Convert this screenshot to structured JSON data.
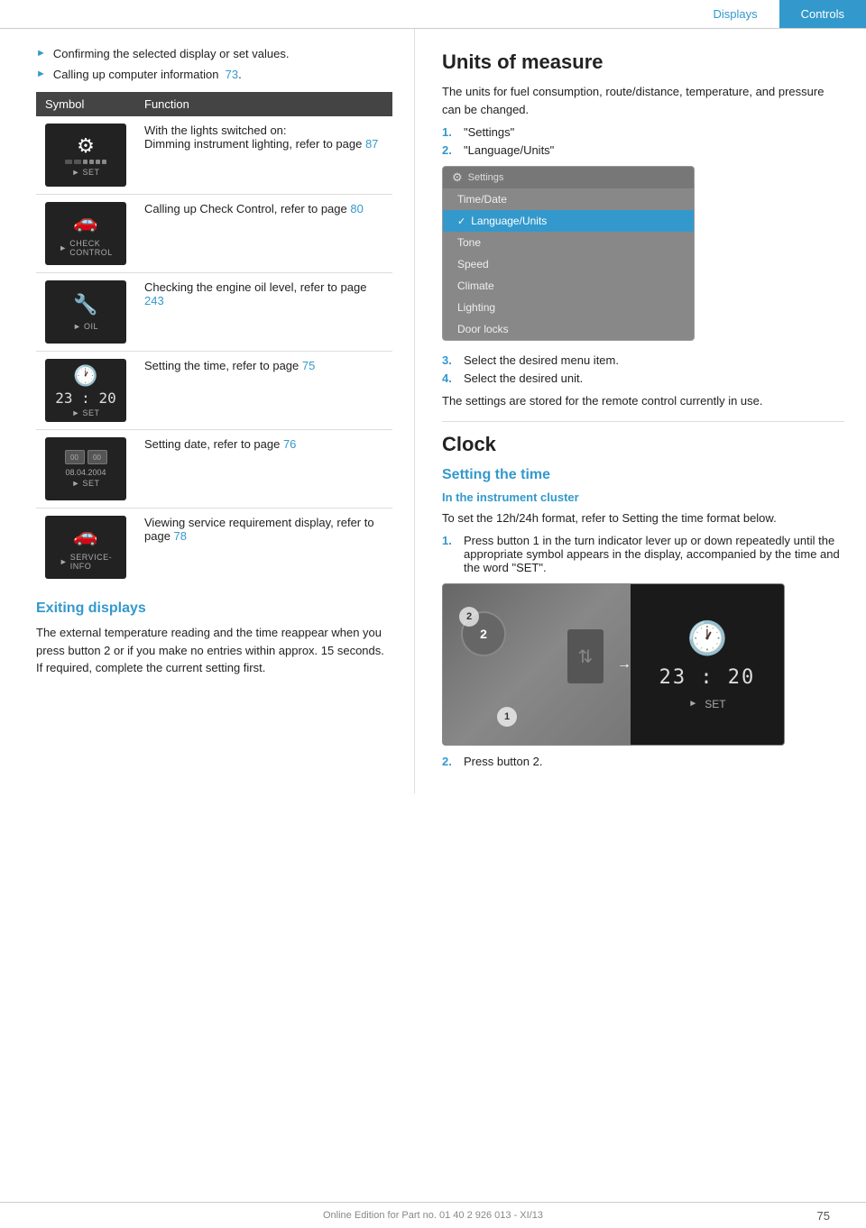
{
  "header": {
    "tab_displays": "Displays",
    "tab_controls": "Controls"
  },
  "left": {
    "bullets": [
      {
        "text": "Confirming the selected display or set values."
      },
      {
        "text": "Calling up computer information",
        "link": "73",
        "link_suffix": "."
      }
    ],
    "table": {
      "col1": "Symbol",
      "col2": "Function",
      "rows": [
        {
          "icon": "⚙",
          "icon_label": "SET",
          "desc_line1": "With the lights switched on:",
          "desc_line2": "Dimming instrument lighting, refer to page ",
          "link": "87"
        },
        {
          "icon": "🚗",
          "icon_label": "CHECK\nCONTROL",
          "desc_line1": "Calling up Check Control, refer to page ",
          "link": "80"
        },
        {
          "icon": "🔧",
          "icon_label": "OIL",
          "desc_line1": "Checking the engine oil level, refer to page ",
          "link": "243"
        },
        {
          "icon": "🕐",
          "icon_label": "SET",
          "time": "23 : 20",
          "desc_line1": "Setting the time, refer to page ",
          "link": "75"
        },
        {
          "icon": "📅",
          "icon_label": "SET",
          "date": "08.04.2004",
          "desc_line1": "Setting date, refer to page ",
          "link": "76"
        },
        {
          "icon": "🚗",
          "icon_label": "SERVICE-\nINFO",
          "desc_line1": "Viewing service requirement display, refer to page ",
          "link": "78"
        }
      ]
    },
    "exiting": {
      "heading": "Exiting displays",
      "para": "The external temperature reading and the time reappear when you press button 2 or if you make no entries within approx. 15 seconds. If required, complete the current setting first."
    }
  },
  "right": {
    "units_section": {
      "heading": "Units of measure",
      "intro": "The units for fuel consumption, route/distance, temperature, and pressure can be changed.",
      "steps": [
        {
          "num": "1.",
          "text": "\"Settings\""
        },
        {
          "num": "2.",
          "text": "\"Language/Units\""
        }
      ],
      "settings_menu": {
        "title": "Settings",
        "items": [
          "Time/Date",
          "Language/Units",
          "Tone",
          "Speed",
          "Climate",
          "Lighting",
          "Door locks"
        ],
        "active": "Language/Units"
      },
      "step3": {
        "num": "3.",
        "text": "Select the desired menu item."
      },
      "step4": {
        "num": "4.",
        "text": "Select the desired unit."
      },
      "closing": "The settings are stored for the remote control currently in use."
    },
    "clock_section": {
      "heading": "Clock",
      "setting_time_heading": "Setting the time",
      "instrument_cluster_heading": "In the instrument cluster",
      "intro": "To set the 12h/24h format, refer to Setting the time format below.",
      "steps": [
        {
          "num": "1.",
          "text": "Press button 1 in the turn indicator lever up or down repeatedly until the appropriate symbol appears in the display, accompanied by the time and the word \"SET\"."
        }
      ],
      "cluster_time": "23 : 20",
      "cluster_set": "SET",
      "step2": {
        "num": "2.",
        "text": "Press button 2."
      },
      "marker1": "1",
      "marker2": "2"
    }
  },
  "footer": {
    "text": "Online Edition for Part no. 01 40 2 926 013 - XI/13",
    "page": "75"
  }
}
